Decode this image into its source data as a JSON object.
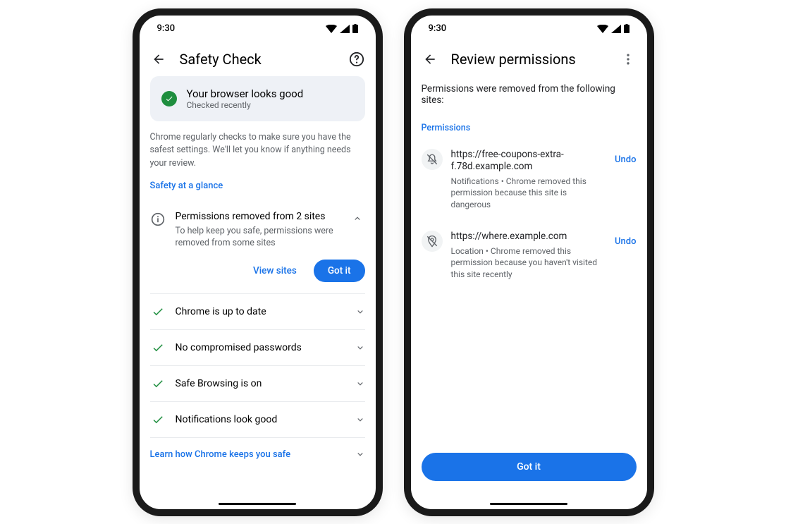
{
  "status_bar": {
    "time": "9:30"
  },
  "left": {
    "title": "Safety Check",
    "status_card": {
      "title": "Your browser looks good",
      "subtitle": "Checked recently"
    },
    "description": "Chrome regularly checks to make sure you have the safest settings. We'll let you know if anything needs your review.",
    "glance_label": "Safety at a glance",
    "permissions": {
      "title": "Permissions removed from 2 sites",
      "subtitle": "To help keep you safe, permissions were removed from some sites",
      "view_label": "View sites",
      "gotit_label": "Got it"
    },
    "checks": [
      "Chrome is up to date",
      "No compromised passwords",
      "Safe Browsing is on",
      "Notifications look good"
    ],
    "learn_label": "Learn how Chrome keeps you safe"
  },
  "right": {
    "title": "Review permissions",
    "description": "Permissions were removed from the following sites:",
    "section_label": "Permissions",
    "sites": [
      {
        "url": "https://free-coupons-extra-f.78d.example.com",
        "detail": "Notifications • Chrome removed this permission because this site is dangerous",
        "undo": "Undo"
      },
      {
        "url": "https://where.example.com",
        "detail": "Location • Chrome removed this permission because you haven't visited this site recently",
        "undo": "Undo"
      }
    ],
    "gotit_label": "Got it"
  }
}
